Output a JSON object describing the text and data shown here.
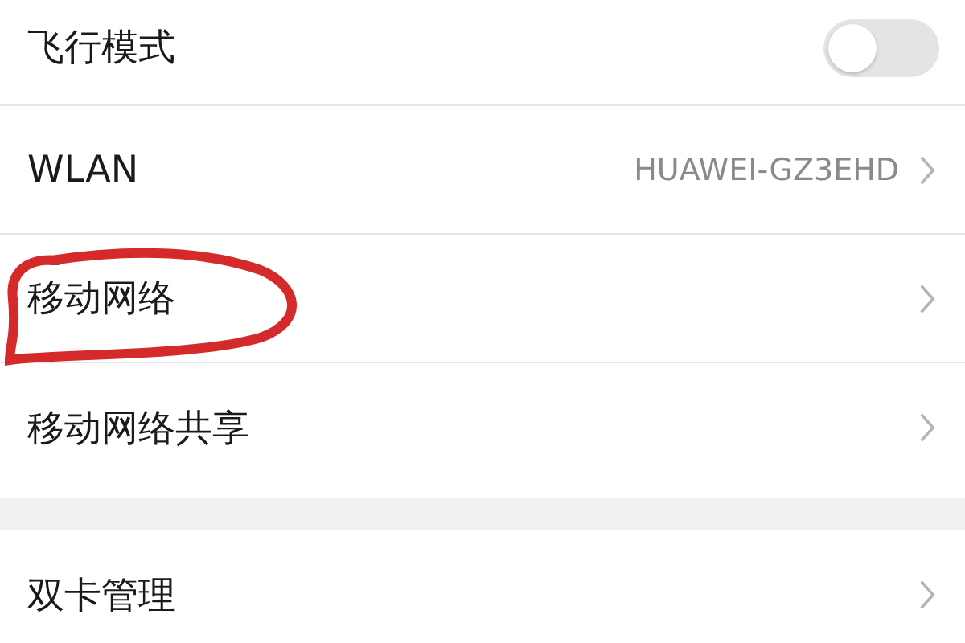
{
  "groups": [
    {
      "rows": [
        {
          "kind": "toggle",
          "label": "飞行模式",
          "on": false
        },
        {
          "kind": "link",
          "label": "WLAN",
          "value": "HUAWEI-GZ3EHD"
        },
        {
          "kind": "link",
          "label": "移动网络",
          "circled": true
        },
        {
          "kind": "link",
          "label": "移动网络共享"
        }
      ]
    },
    {
      "rows": [
        {
          "kind": "link",
          "label": "双卡管理"
        }
      ]
    }
  ]
}
